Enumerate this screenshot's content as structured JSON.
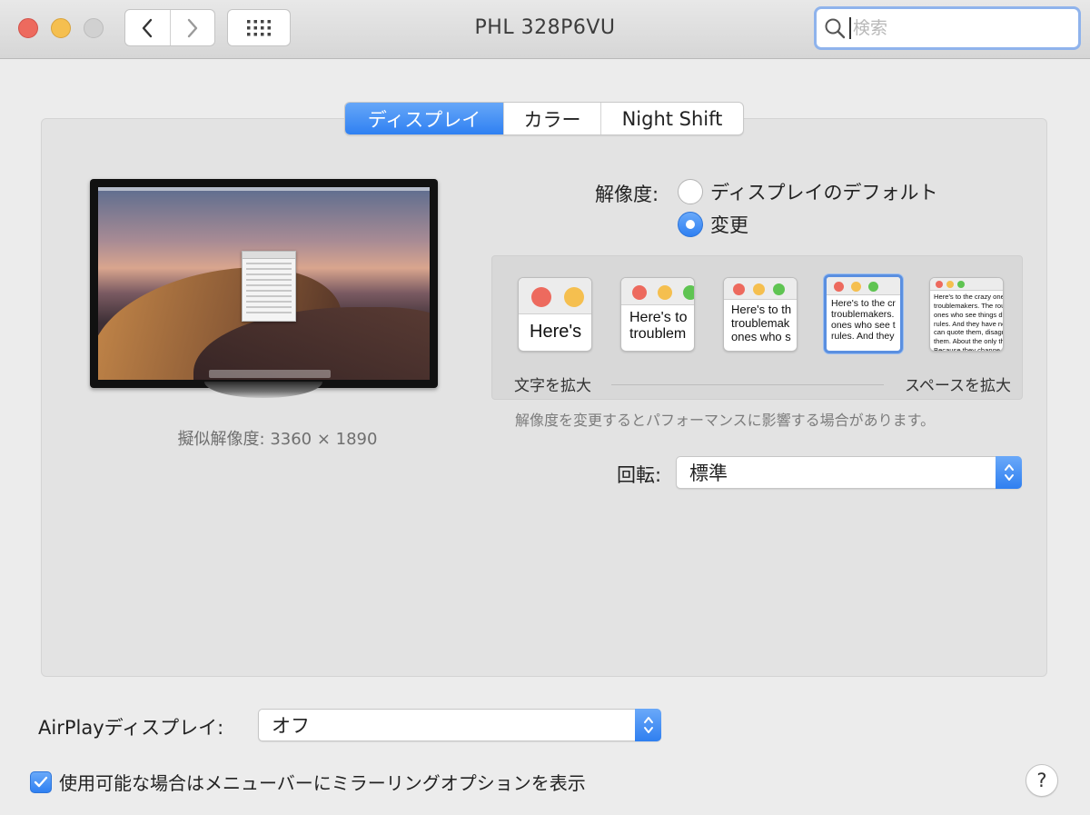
{
  "window": {
    "title": "PHL 328P6VU"
  },
  "search": {
    "placeholder": "検索",
    "value": ""
  },
  "tabs": [
    {
      "label": "ディスプレイ",
      "active": true
    },
    {
      "label": "カラー",
      "active": false
    },
    {
      "label": "Night Shift",
      "active": false
    }
  ],
  "preview": {
    "pseudo_resolution": "擬似解像度: 3360 × 1890"
  },
  "resolution": {
    "label": "解像度:",
    "options": [
      {
        "label": "ディスプレイのデフォルト",
        "selected": false
      },
      {
        "label": "変更",
        "selected": true
      }
    ]
  },
  "scale": {
    "thumbnails": [
      {
        "text": "Here's",
        "selected": false
      },
      {
        "text": "Here's to\ntroublem",
        "selected": false
      },
      {
        "text": "Here's to th\ntroublemak\nones who s",
        "selected": false
      },
      {
        "text": "Here's to the cr\ntroublemakers.\nones who see t\nrules. And they",
        "selected": true
      },
      {
        "text": "Here's to the crazy ones\ntroublemakers. The rou\nones who see things dif\nrules. And they have no\ncan quote them, disagr\nthem. About the only th\nBecause they change t",
        "selected": false
      }
    ],
    "left_label": "文字を拡大",
    "right_label": "スペースを拡大",
    "note": "解像度を変更するとパフォーマンスに影響する場合があります。"
  },
  "rotation": {
    "label": "回転:",
    "value": "標準"
  },
  "airplay": {
    "label": "AirPlayディスプレイ:",
    "value": "オフ"
  },
  "mirror_option": {
    "label": "使用可能な場合はメニューバーにミラーリングオプションを表示",
    "checked": true
  },
  "help": {
    "label": "?"
  },
  "colors": {
    "accent": "#2f80f2",
    "close": "#ed6a5e",
    "minimize": "#f5bf4f",
    "zoom": "#d1d1d1"
  }
}
